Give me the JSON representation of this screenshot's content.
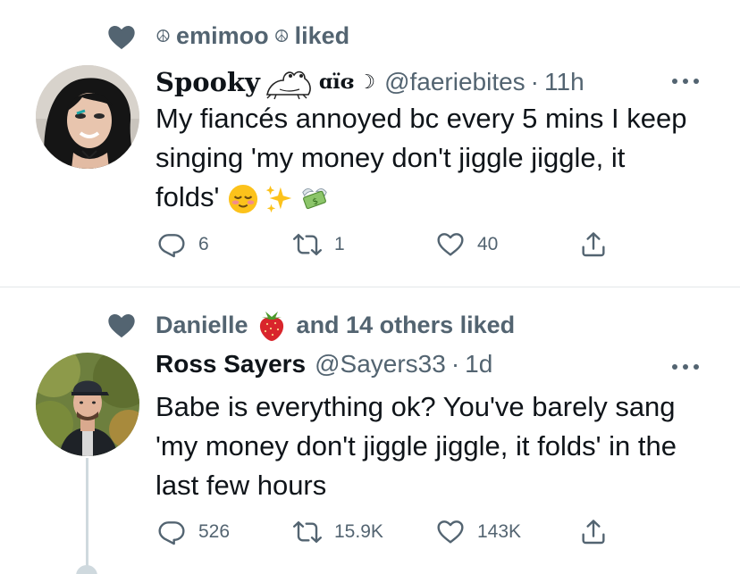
{
  "tweets": [
    {
      "social_context": {
        "user1": "emimoo",
        "peace": "☮",
        "verb": "liked"
      },
      "display_name": "Spooky",
      "name_suffix": "ɑïɞ",
      "moon": "☽",
      "handle": "@faeriebites",
      "dot": "·",
      "time": "11h",
      "text": "My fiancés annoyed bc every 5 mins I keep singing 'my money don't jiggle jiggle, it folds'",
      "emojis": [
        "relieved-face",
        "sparkles",
        "money-with-wings"
      ],
      "actions": {
        "replies": "6",
        "retweets": "1",
        "likes": "40"
      }
    },
    {
      "social_context": {
        "user1": "Danielle",
        "verb": "and 14 others liked"
      },
      "display_name": "Ross Sayers",
      "handle": "@Sayers33",
      "dot": "·",
      "time": "1d",
      "text": "Babe is everything ok? You've barely sang 'my money don't jiggle jiggle, it folds' in the last few hours",
      "actions": {
        "replies": "526",
        "retweets": "15.9K",
        "likes": "143K"
      }
    }
  ],
  "colors": {
    "secondary": "#536471",
    "text": "#0f1419",
    "divider": "#e3e7ea"
  }
}
